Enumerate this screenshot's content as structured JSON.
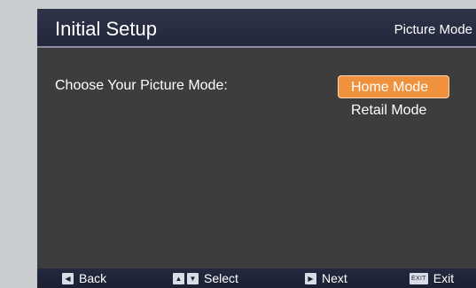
{
  "header": {
    "title": "Initial Setup",
    "section": "Picture Mode"
  },
  "main": {
    "prompt": "Choose Your Picture Mode:",
    "options": [
      {
        "label": "Home Mode",
        "selected": true
      },
      {
        "label": "Retail Mode",
        "selected": false
      }
    ]
  },
  "footer": {
    "back": {
      "icon": "left-arrow-icon",
      "glyph": "◀",
      "label": "Back"
    },
    "select": {
      "icon": "up-down-arrows-icon",
      "glyph_up": "▲",
      "glyph_down": "▼",
      "label": "Select"
    },
    "next": {
      "icon": "right-arrow-icon",
      "glyph": "▶",
      "label": "Next"
    },
    "exit": {
      "icon": "exit-key-icon",
      "glyph": "EXIT",
      "label": "Exit"
    }
  },
  "colors": {
    "header_bg": "#2e3349",
    "panel_bg": "#3d3d3d",
    "highlight": "#f0923d",
    "outer_bg": "#c9ccce"
  }
}
